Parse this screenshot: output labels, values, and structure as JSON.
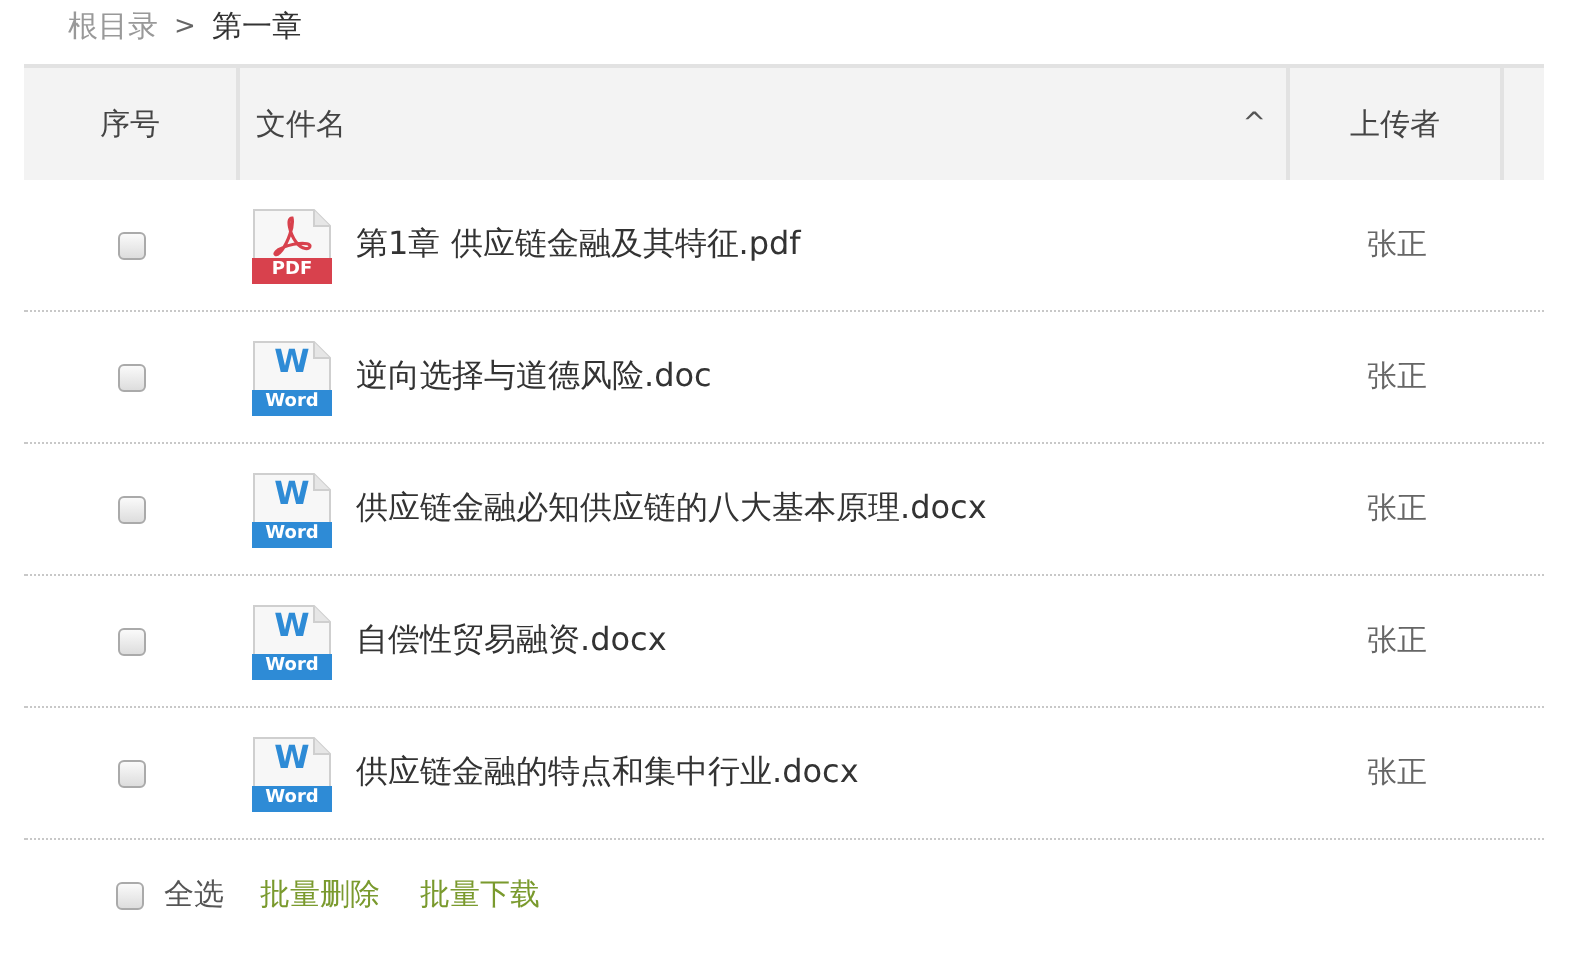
{
  "breadcrumb": {
    "root": "根目录",
    "separator": ">",
    "current": "第一章"
  },
  "table": {
    "columns": [
      {
        "label": "序号"
      },
      {
        "label": "文件名",
        "sort_icon": "^"
      },
      {
        "label": "上传者"
      }
    ],
    "rows": [
      {
        "checked": false,
        "kind": "pdf",
        "icon_text": "PDF",
        "name": "第1章 供应链金融及其特征.pdf",
        "uploader": "张正"
      },
      {
        "checked": false,
        "kind": "word",
        "icon_letter": "W",
        "icon_text": "Word",
        "name": "逆向选择与道德风险.doc",
        "uploader": "张正"
      },
      {
        "checked": false,
        "kind": "word",
        "icon_letter": "W",
        "icon_text": "Word",
        "name": "供应链金融必知供应链的八大基本原理.docx",
        "uploader": "张正"
      },
      {
        "checked": false,
        "kind": "word",
        "icon_letter": "W",
        "icon_text": "Word",
        "name": "自偿性贸易融资.docx",
        "uploader": "张正"
      },
      {
        "checked": false,
        "kind": "word",
        "icon_letter": "W",
        "icon_text": "Word",
        "name": "供应链金融的特点和集中行业.docx",
        "uploader": "张正"
      }
    ]
  },
  "footer": {
    "select_all": {
      "label": "全选",
      "checked": false
    },
    "actions": [
      "批量删除",
      "批量下载"
    ]
  }
}
